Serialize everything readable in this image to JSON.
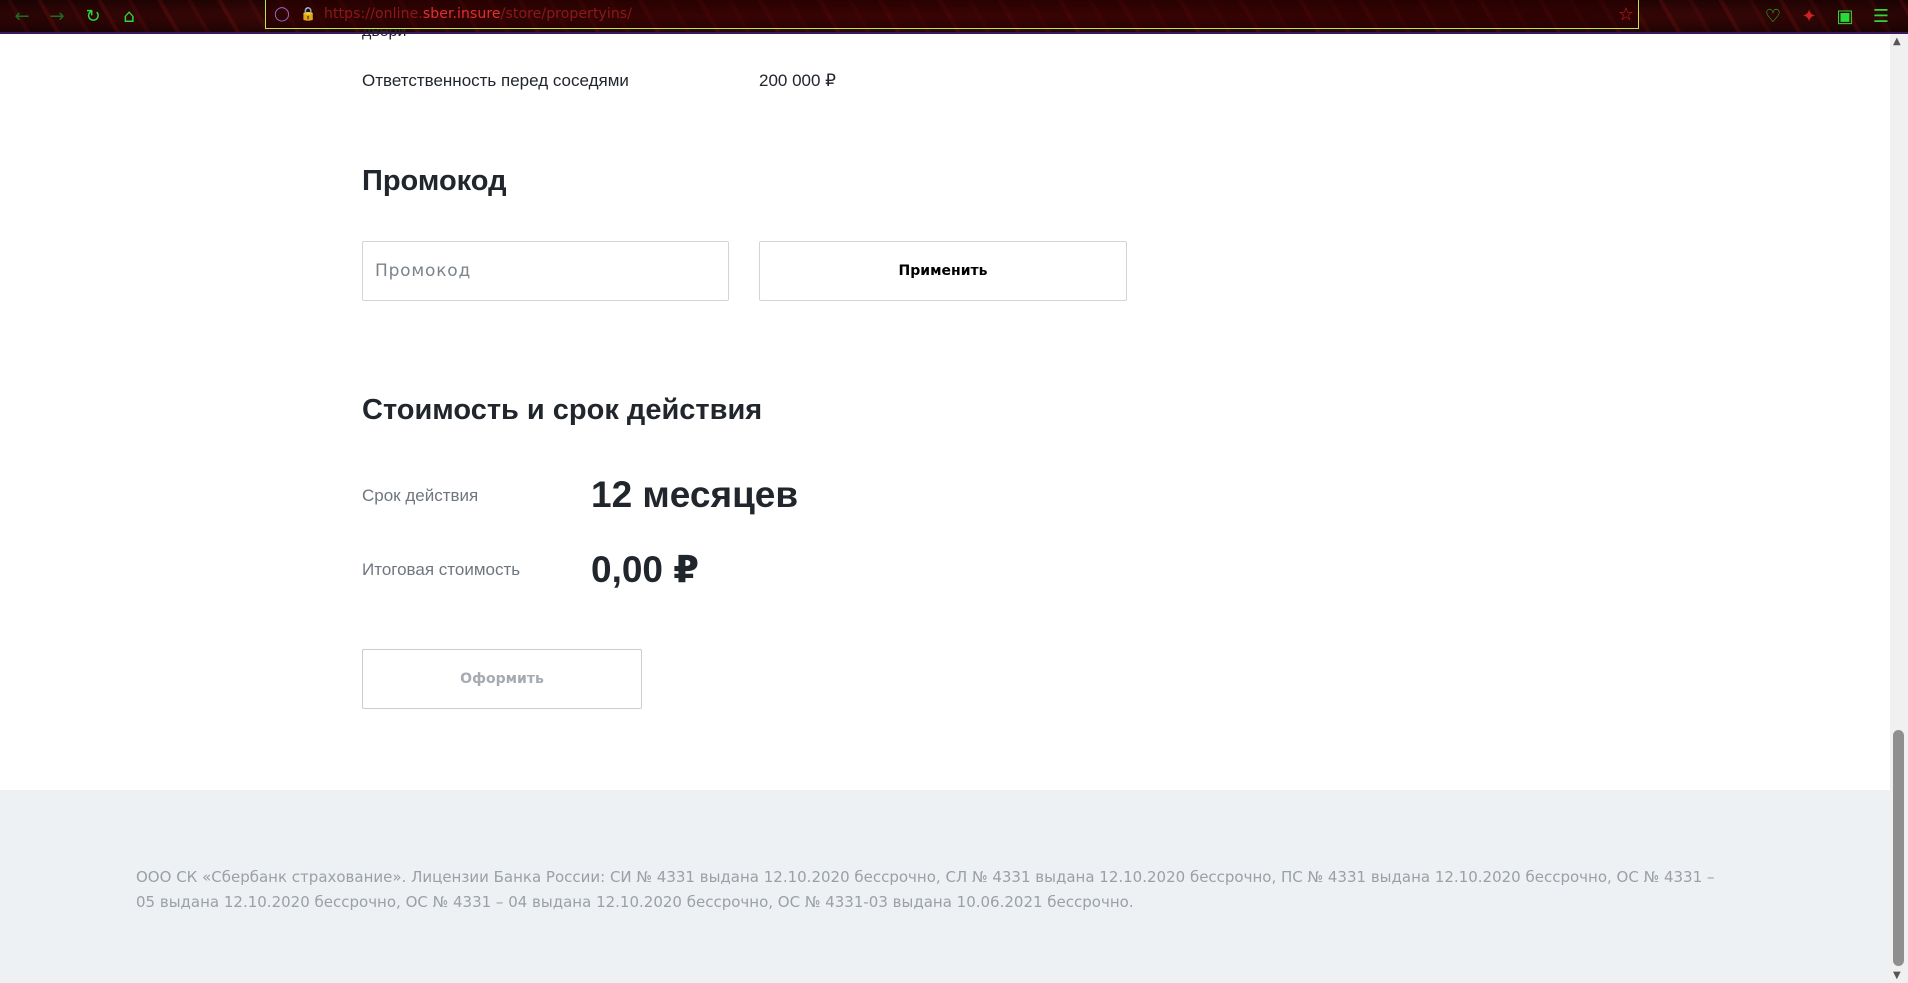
{
  "browser": {
    "url_prefix": "https://online.",
    "url_domain": "sber.insure",
    "url_path": "/store/propertyins/",
    "icons": {
      "back": "arrow-left-icon",
      "forward": "arrow-right-icon",
      "reload": "reload-icon",
      "home": "home-icon",
      "shield": "shield-icon",
      "lock": "lock-icon",
      "bookmark": "star-icon",
      "pocket": "pocket-icon",
      "addon": "addon-icon",
      "extensions": "puzzle-icon",
      "menu": "hamburger-menu-icon"
    },
    "accent": "#2bd93a"
  },
  "coverage": {
    "cut_text": "двери",
    "row_label": "Ответственность перед соседями",
    "row_value": "200 000 ₽"
  },
  "promo": {
    "heading": "Промокод",
    "input_placeholder": "Промокод",
    "input_value": "",
    "apply_label": "Применить"
  },
  "cost": {
    "heading": "Стоимость и срок действия",
    "term_label": "Срок действия",
    "term_value": "12 месяцев",
    "total_label": "Итоговая стоимость",
    "total_value": "0,00 ₽",
    "submit_label": "Оформить"
  },
  "footer": {
    "legal_text": "ООО СК «Сбербанк страхование». Лицензии Банка России: СИ № 4331 выдана 12.10.2020 бессрочно, СЛ № 4331 выдана 12.10.2020 бессрочно, ПС № 4331 выдана 12.10.2020 бессрочно, ОС № 4331 – 05 выдана 12.10.2020 бессрочно, ОС № 4331 – 04 выдана 12.10.2020 бессрочно, ОС № 4331-03 выдана 10.06.2021 бессрочно."
  }
}
